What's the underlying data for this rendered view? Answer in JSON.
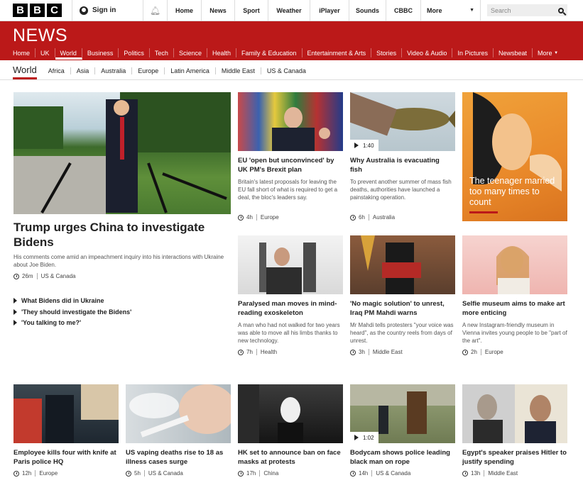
{
  "topbar": {
    "logo": [
      "B",
      "B",
      "C"
    ],
    "signin": "Sign in",
    "nav": [
      "Home",
      "News",
      "Sport",
      "Weather",
      "iPlayer",
      "Sounds",
      "CBBC"
    ],
    "more": "More",
    "search_placeholder": "Search"
  },
  "news": {
    "brand": "NEWS",
    "sections": [
      "Home",
      "UK",
      "World",
      "Business",
      "Politics",
      "Tech",
      "Science",
      "Health",
      "Family & Education",
      "Entertainment & Arts",
      "Stories",
      "Video & Audio",
      "In Pictures",
      "Newsbeat",
      "More"
    ]
  },
  "regions": {
    "current": "World",
    "items": [
      "Africa",
      "Asia",
      "Australia",
      "Europe",
      "Latin America",
      "Middle East",
      "US & Canada"
    ]
  },
  "lead": {
    "headline": "Trump urges China to investigate Bidens",
    "summary": "His comments come amid an impeachment inquiry into his interactions with Ukraine about Joe Biden.",
    "time": "26m",
    "region": "US & Canada",
    "related": [
      "What Bidens did in Ukraine",
      "'They should investigate the Bidens'",
      "'You talking to me?'"
    ]
  },
  "stories": [
    {
      "headline": "EU 'open but unconvinced' by UK PM's Brexit plan",
      "summary": "Britain's latest proposals for leaving the EU fall short of what is required to get a deal, the bloc's leaders say.",
      "time": "4h",
      "region": "Europe"
    },
    {
      "headline": "Why Australia is evacuating fish",
      "summary": "To prevent another summer of mass fish deaths, authorities have launched a painstaking operation.",
      "time": "6h",
      "region": "Australia",
      "video": "1:40"
    },
    {
      "headline": "The teenager married too many times to count"
    },
    {
      "headline": "Paralysed man moves in mind-reading exoskeleton",
      "summary": "A man who had not walked for two years was able to move all his limbs thanks to new technology.",
      "time": "7h",
      "region": "Health"
    },
    {
      "headline": "'No magic solution' to unrest, Iraq PM Mahdi warns",
      "summary": "Mr Mahdi tells protesters \"your voice was heard\", as the country reels from days of unrest.",
      "time": "3h",
      "region": "Middle East"
    },
    {
      "headline": "Selfie museum aims to make art more enticing",
      "summary": "A new Instagram-friendly museum in Vienna invites young people to be \"part of the art\".",
      "time": "2h",
      "region": "Europe"
    }
  ],
  "bottom": [
    {
      "headline": "Employee kills four with knife at Paris police HQ",
      "time": "12h",
      "region": "Europe"
    },
    {
      "headline": "US vaping deaths rise to 18 as illness cases surge",
      "time": "5h",
      "region": "US & Canada"
    },
    {
      "headline": "HK set to announce ban on face masks at protests",
      "time": "17h",
      "region": "China"
    },
    {
      "headline": "Bodycam shows police leading black man on rope",
      "time": "14h",
      "region": "US & Canada",
      "video": "1:02"
    },
    {
      "headline": "Egypt's speaker praises Hitler to justify spending",
      "time": "13h",
      "region": "Middle East"
    }
  ],
  "colors": {
    "brand_red": "#bb1919",
    "text": "#222222"
  }
}
